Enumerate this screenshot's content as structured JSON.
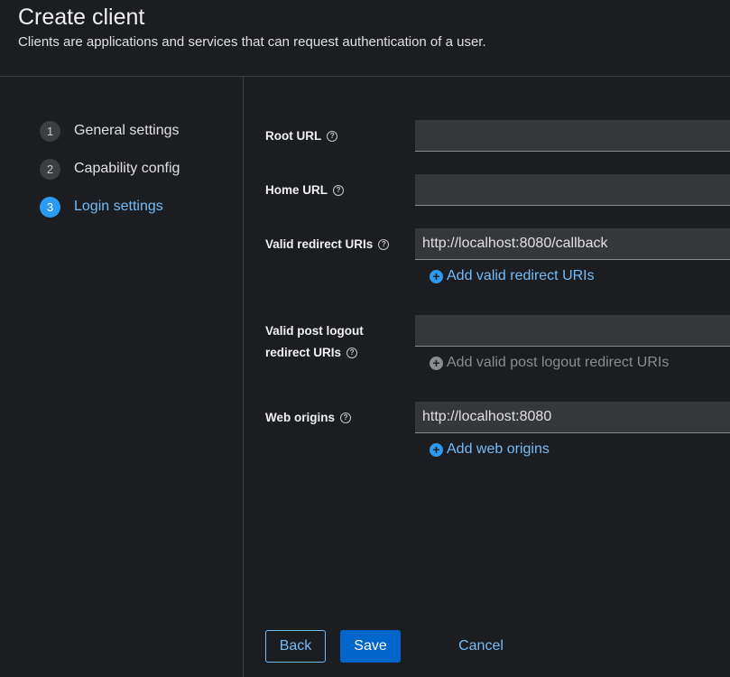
{
  "header": {
    "title": "Create client",
    "subtitle": "Clients are applications and services that can request authentication of a user."
  },
  "wizard": {
    "steps": [
      {
        "number": "1",
        "label": "General settings"
      },
      {
        "number": "2",
        "label": "Capability config"
      },
      {
        "number": "3",
        "label": "Login settings",
        "active": true
      }
    ]
  },
  "form": {
    "root_url": {
      "label": "Root URL",
      "value": ""
    },
    "home_url": {
      "label": "Home URL",
      "value": ""
    },
    "valid_redirect_uris": {
      "label": "Valid redirect URIs",
      "value": "http://localhost:8080/callback",
      "add_label": "Add valid redirect URIs"
    },
    "valid_post_logout": {
      "label_line1": "Valid post logout",
      "label_line2": "redirect URIs",
      "value": "",
      "add_label": "Add valid post logout redirect URIs"
    },
    "web_origins": {
      "label": "Web origins",
      "value": "http://localhost:8080",
      "add_label": "Add web origins"
    },
    "help_glyph": "?"
  },
  "actions": {
    "back": "Back",
    "save": "Save",
    "cancel": "Cancel"
  },
  "colors": {
    "background": "#1b1d21",
    "accent": "#73bcf7",
    "primary": "#0066cc",
    "input_bg": "#36373b"
  }
}
